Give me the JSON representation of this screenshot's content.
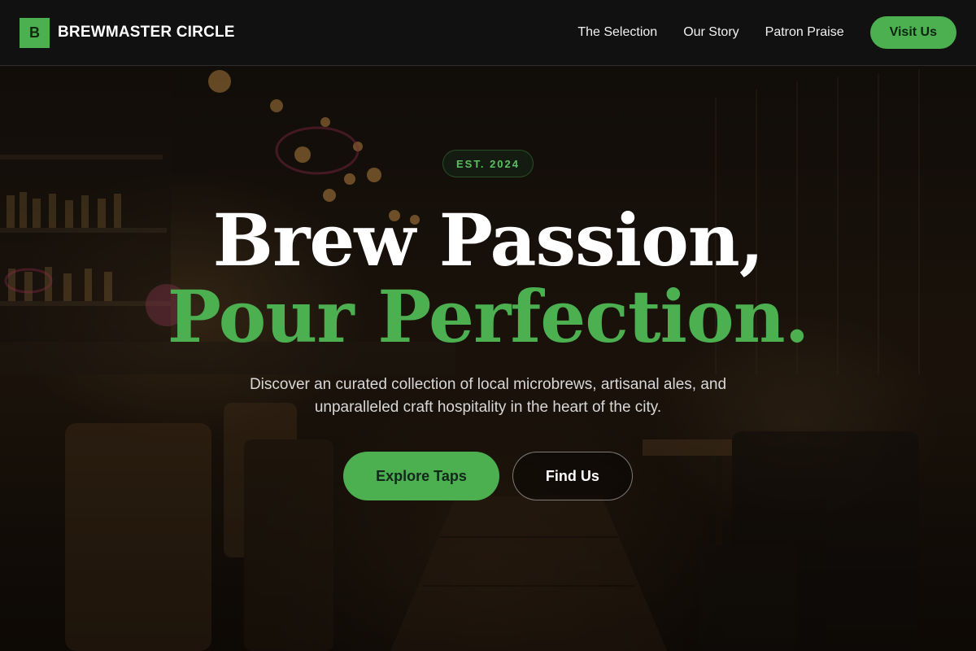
{
  "header": {
    "brand_mark": "B",
    "brand_name": "BREWMASTER CIRCLE",
    "nav": [
      {
        "label": "The Selection"
      },
      {
        "label": "Our Story"
      },
      {
        "label": "Patron Praise"
      }
    ],
    "cta_label": "Visit Us"
  },
  "hero": {
    "badge": "EST. 2024",
    "headline_line1": "Brew Passion,",
    "headline_line2": "Pour Perfection.",
    "subtitle": "Discover an curated collection of local microbrews, artisanal ales, and unparalleled craft hospitality in the heart of the city.",
    "primary_button": "Explore Taps",
    "secondary_button": "Find Us",
    "background_icon": "bar-interior-photo"
  },
  "colors": {
    "accent": "#4caf50",
    "header_bg": "#121212",
    "text": "#ffffff",
    "subtitle": "#d8d8d8"
  }
}
